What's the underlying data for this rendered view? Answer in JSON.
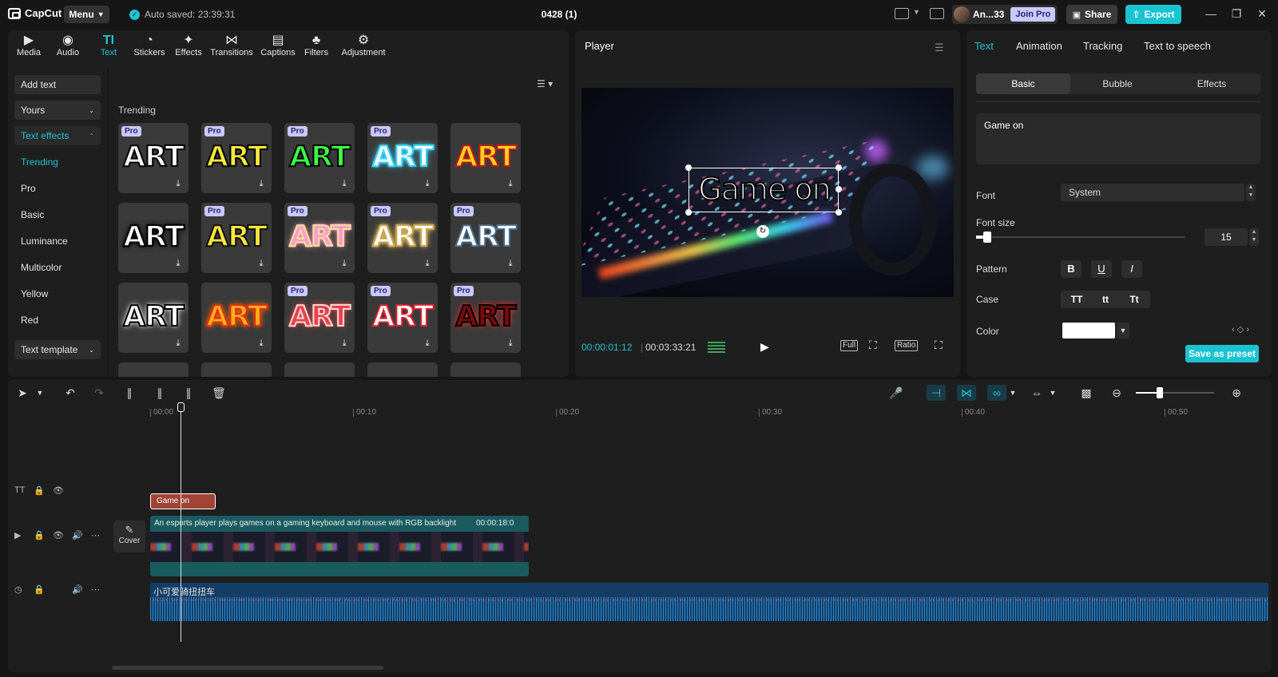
{
  "titlebar": {
    "app_name": "CapCut",
    "menu_label": "Menu",
    "autosave": "Auto saved: 23:39:31",
    "project_title": "0428 (1)",
    "user_name": "An...33",
    "join_pro": "Join Pro",
    "share": "Share",
    "export": "Export"
  },
  "media_tabs": [
    {
      "label": "Media",
      "icon": "media-icon"
    },
    {
      "label": "Audio",
      "icon": "audio-icon"
    },
    {
      "label": "Text",
      "icon": "text-icon",
      "active": true
    },
    {
      "label": "Stickers",
      "icon": "stickers-icon"
    },
    {
      "label": "Effects",
      "icon": "effects-icon"
    },
    {
      "label": "Transitions",
      "icon": "transitions-icon"
    },
    {
      "label": "Captions",
      "icon": "captions-icon"
    },
    {
      "label": "Filters",
      "icon": "filters-icon"
    },
    {
      "label": "Adjustment",
      "icon": "adjustment-icon"
    }
  ],
  "sidebar": {
    "add_text": "Add text",
    "yours": "Yours",
    "text_effects": "Text effects",
    "items": [
      "Trending",
      "Pro",
      "Basic",
      "Luminance",
      "Multicolor",
      "Yellow",
      "Red"
    ],
    "text_template": "Text template"
  },
  "gallery": {
    "section_label": "Trending",
    "pro_badge": "Pro",
    "tile_text": "ART",
    "tiles": [
      {
        "pro": true,
        "fill": "#ffffff",
        "stroke": "#000000",
        "glow": ""
      },
      {
        "pro": true,
        "fill": "#ffe93a",
        "stroke": "#000000",
        "glow": ""
      },
      {
        "pro": true,
        "fill": "#3bff48",
        "stroke": "#000000",
        "glow": ""
      },
      {
        "pro": true,
        "fill": "#ffffff",
        "stroke": "#38d6ff",
        "glow": "#38d6ff"
      },
      {
        "pro": false,
        "fill": "#ffd21e",
        "stroke": "#c01a1a",
        "glow": ""
      },
      {
        "pro": false,
        "fill": "#ffffff",
        "stroke": "#000000",
        "glow": "#000000"
      },
      {
        "pro": true,
        "fill": "#ffe93a",
        "stroke": "#111111",
        "glow": ""
      },
      {
        "pro": true,
        "fill": "#ff9ad0",
        "stroke": "#ffe0a0",
        "glow": "#ffb0b0"
      },
      {
        "pro": true,
        "fill": "#ffffff",
        "stroke": "#c9a44a",
        "glow": "#ffcf6a"
      },
      {
        "pro": true,
        "fill": "#ffffff",
        "stroke": "#4a6b8a",
        "glow": ""
      },
      {
        "pro": false,
        "fill": "#ffffff",
        "stroke": "#000000",
        "glow": "#ffffff"
      },
      {
        "pro": false,
        "fill": "#ffae1a",
        "stroke": "#e02a12",
        "glow": "#ff6a00"
      },
      {
        "pro": true,
        "fill": "#e8424a",
        "stroke": "#ffd8d8",
        "glow": "#ff4a4a"
      },
      {
        "pro": true,
        "fill": "#ffffff",
        "stroke": "#e02030",
        "glow": ""
      },
      {
        "pro": true,
        "fill": "#7a0a0a",
        "stroke": "#000000",
        "glow": "#ff2a2a"
      }
    ]
  },
  "player": {
    "title": "Player",
    "caption": "Game on",
    "current_time": "00:00:01:12",
    "total_time": "00:03:33:21",
    "full": "Full",
    "ratio": "Ratio"
  },
  "props": {
    "tabs": [
      "Text",
      "Animation",
      "Tracking",
      "Text to speech"
    ],
    "segments": [
      "Basic",
      "Bubble",
      "Effects"
    ],
    "text_value": "Game on",
    "font_label": "Font",
    "font_value": "System",
    "font_size_label": "Font size",
    "font_size_value": "15",
    "font_size_fraction": 0.05,
    "pattern_label": "Pattern",
    "pattern_buttons": [
      "B",
      "U",
      "I"
    ],
    "case_label": "Case",
    "case_buttons": [
      "TT",
      "tt",
      "Tt"
    ],
    "color_label": "Color",
    "color_value": "#ffffff",
    "save_preset": "Save as preset"
  },
  "timeline": {
    "ruler": [
      "00:00",
      "00:10",
      "00:20",
      "00:30",
      "00:40",
      "00:50"
    ],
    "text_clip": "Game on",
    "video_clip_label": "An esports player plays games on a gaming keyboard and mouse with RGB backlight",
    "video_clip_duration": "00:00:18:0",
    "cover": "Cover",
    "audio_clip_label": "小可爱骑扭扭车"
  },
  "colors": {
    "accent": "#19c3d2",
    "pro_badge": "#c9c9ff",
    "text_clip": "#a14436",
    "video_clip": "#1a5b5f",
    "audio_clip": "#143d66"
  }
}
